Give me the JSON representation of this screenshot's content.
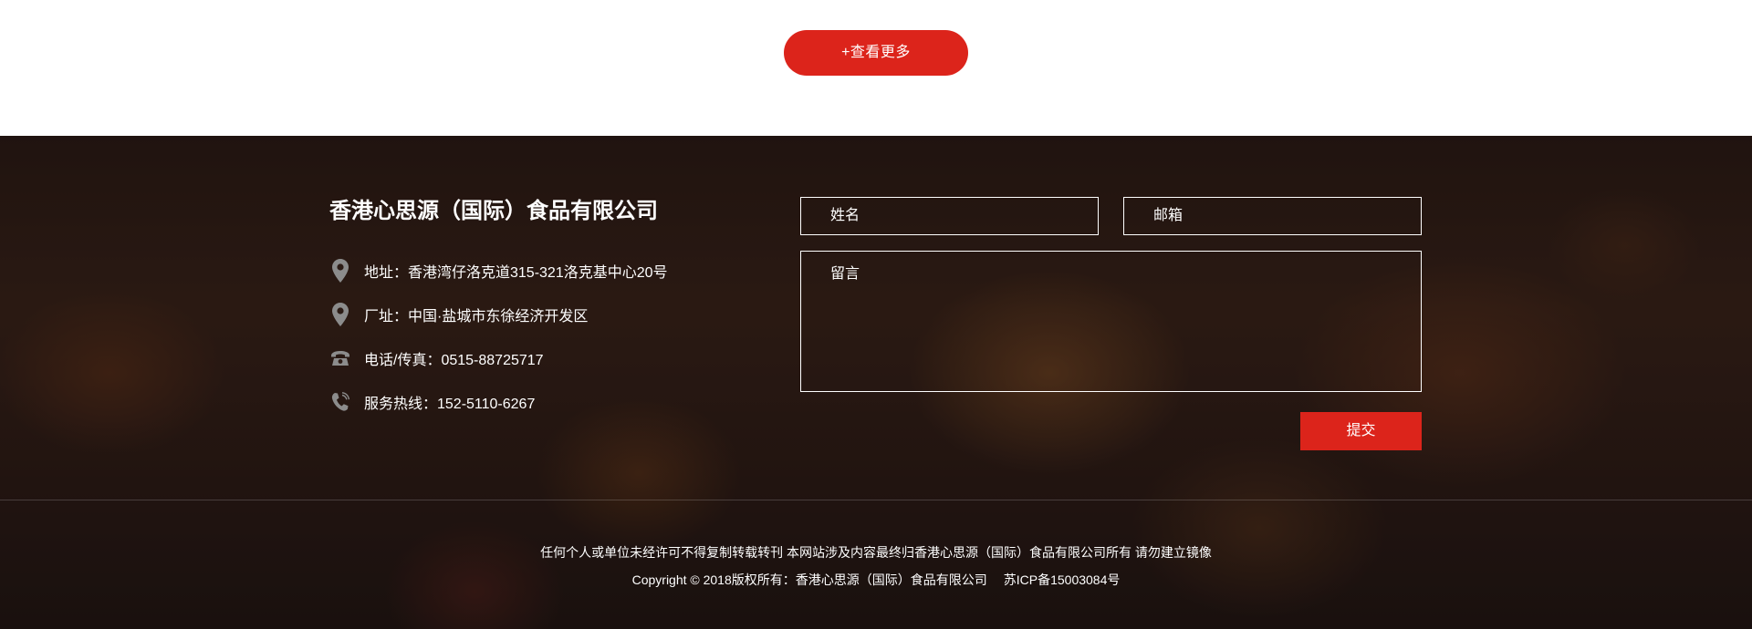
{
  "more_button": {
    "label": "+查看更多"
  },
  "footer": {
    "company_name": "香港心思源（国际）食品有限公司",
    "contacts": [
      {
        "icon": "location-pin-icon",
        "text": "地址：香港湾仔洛克道315-321洛克基中心20号"
      },
      {
        "icon": "location-pin-icon",
        "text": "厂址：中国·盐城市东徐经济开发区"
      },
      {
        "icon": "telephone-icon",
        "text": "电话/传真：0515-88725717"
      },
      {
        "icon": "phone-handset-icon",
        "text": "服务热线：152-5110-6267"
      }
    ],
    "form": {
      "name_placeholder": "姓名",
      "email_placeholder": "邮箱",
      "message_placeholder": "留言",
      "submit_label": "提交"
    },
    "legal": {
      "notice": "任何个人或单位未经许可不得复制转载转刊 本网站涉及内容最终归香港心思源（国际）食品有限公司所有 请勿建立镜像",
      "copyright": "Copyright © 2018版权所有：香港心思源（国际）食品有限公司",
      "icp": "苏ICP备15003084号"
    }
  },
  "colors": {
    "accent": "#dc241b",
    "footer_text": "#ffffff",
    "icon_gray": "#8c8c8c"
  }
}
